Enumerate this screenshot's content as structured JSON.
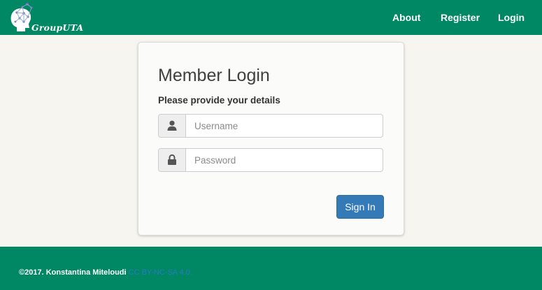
{
  "navbar": {
    "brand": "GroupUTA",
    "links": [
      "About",
      "Register",
      "Login"
    ]
  },
  "login": {
    "title": "Member Login",
    "subtitle": "Please provide your details",
    "username_placeholder": "Username",
    "password_placeholder": "Password",
    "submit_label": "Sign In"
  },
  "footer": {
    "copyright": "©2017. Konstantina Miteloudi",
    "license": "CC BY-NC-SA 4.0."
  },
  "icons": {
    "logo": "brain-network-logo-icon",
    "username": "user-icon",
    "password": "lock-icon"
  },
  "colors": {
    "brand_green": "#008764",
    "primary_button": "#337ab7",
    "license_link": "#2a7ac2",
    "page_background": "#f7f5f0"
  }
}
